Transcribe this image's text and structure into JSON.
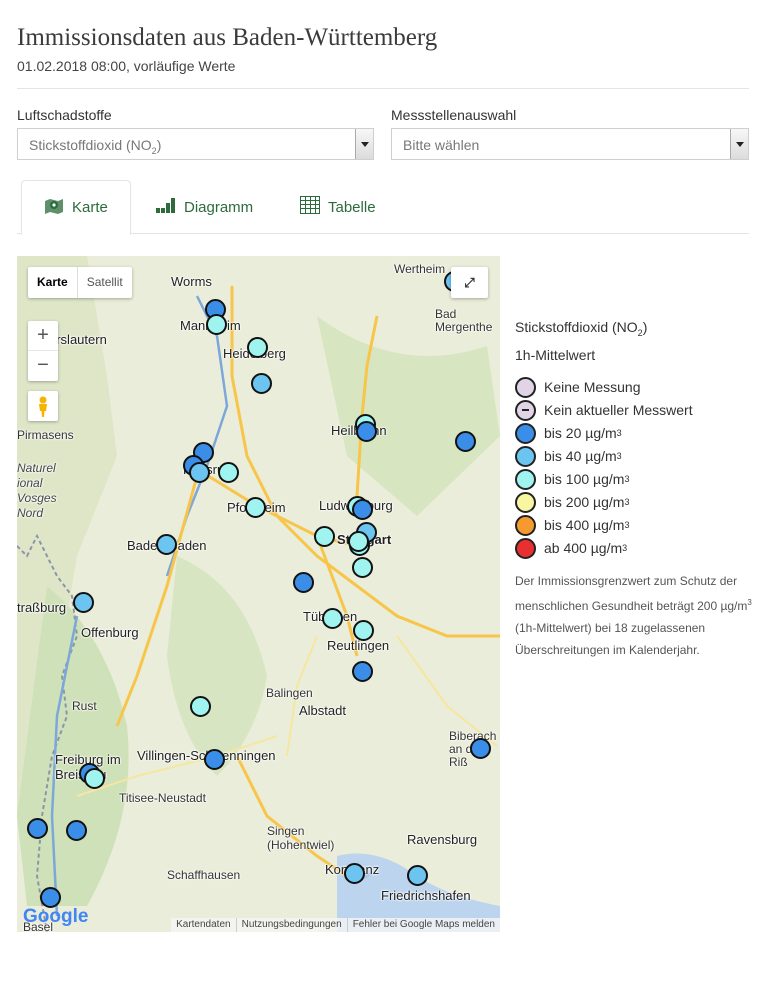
{
  "header": {
    "title": "Immissionsdaten aus Baden-Württemberg",
    "subtitle": "01.02.2018 08:00, vorläufige Werte"
  },
  "filters": {
    "pollutant_label": "Luftschadstoffe",
    "pollutant_value": "Stickstoffdioxid (NO",
    "pollutant_value_sub": "2",
    "pollutant_value_end": ")",
    "station_label": "Messstellenauswahl",
    "station_value": "Bitte wählen"
  },
  "tabs": [
    {
      "label": "Karte",
      "icon": "map-pin-icon"
    },
    {
      "label": "Diagramm",
      "icon": "bar-chart-icon"
    },
    {
      "label": "Tabelle",
      "icon": "table-icon"
    }
  ],
  "map": {
    "maptype_map": "Karte",
    "maptype_satellite": "Satellit",
    "zoom_in": "+",
    "zoom_out": "−",
    "fullscreen": "⤢",
    "google": "Google",
    "attribution": [
      "Kartendaten",
      "Nutzungsbedingungen",
      "Fehler bei Google Maps melden"
    ],
    "labels": {
      "worms": "Worms",
      "mannheim": "Mannheim",
      "heidelberg": "Heidelberg",
      "kaiserslautern": "erslautern",
      "pirmasens": "Pirmasens",
      "karlsruhe": "Karlsruhe",
      "pforzheim": "Pforzheim",
      "baden_baden": "Baden-Baden",
      "heilbronn": "Heilbronn",
      "ludwigsburg": "Ludwigsburg",
      "stuttgart": "Stuttgart",
      "wertheim": "Wertheim",
      "bad_mergentheim": "Bad Mergenthe",
      "strassburg": "traßburg",
      "offenburg": "Offenburg",
      "tuebingen": "Tübingen",
      "reutlingen": "Reutlingen",
      "balingen": "Balingen",
      "albstadt": "Albstadt",
      "rust": "Rust",
      "freiburg": "Freiburg im Breisgau",
      "villingen": "Villingen-Schwenningen",
      "titisee": "Titisee-Neustadt",
      "singen": "Singen (Hohentwiel)",
      "schaffhausen": "Schaffhausen",
      "konstanz": "Konstanz",
      "ravensburg": "Ravensburg",
      "friedrichshafen": "Friedrichshafen",
      "biberach": "Biberach an der Riß",
      "basel": "Basel",
      "vosges": "Naturel ional Vosges Nord"
    },
    "stations": [
      {
        "level": "bis 20 µg/m³"
      },
      {
        "level": "bis 100 µg/m³"
      },
      {
        "level": "bis 100 µg/m³"
      },
      {
        "level": "bis 40 µg/m³"
      },
      {
        "level": "bis 20 µg/m³"
      },
      {
        "level": "bis 20 µg/m³"
      },
      {
        "level": "bis 40 µg/m³"
      },
      {
        "level": "bis 100 µg/m³"
      },
      {
        "level": "bis 100 µg/m³"
      },
      {
        "level": "bis 20 µg/m³"
      },
      {
        "level": "bis 20 µg/m³"
      },
      {
        "level": "bis 100 µg/m³"
      },
      {
        "level": "bis 100 µg/m³"
      },
      {
        "level": "bis 20 µg/m³"
      },
      {
        "level": "bis 40 µg/m³"
      },
      {
        "level": "bis 100 µg/m³"
      },
      {
        "level": "bis 40 µg/m³"
      },
      {
        "level": "bis 100 µg/m³"
      },
      {
        "level": "bis 100 µg/m³"
      },
      {
        "level": "bis 100 µg/m³"
      },
      {
        "level": "bis 20 µg/m³"
      },
      {
        "level": "bis 40 µg/m³"
      },
      {
        "level": "bis 100 µg/m³"
      },
      {
        "level": "bis 100 µg/m³"
      },
      {
        "level": "bis 20 µg/m³"
      },
      {
        "level": "bis 100 µg/m³"
      },
      {
        "level": "bis 20 µg/m³"
      },
      {
        "level": "bis 20 µg/m³"
      },
      {
        "level": "bis 100 µg/m³"
      },
      {
        "level": "bis 20 µg/m³"
      },
      {
        "level": "bis 20 µg/m³"
      },
      {
        "level": "bis 40 µg/m³"
      },
      {
        "level": "bis 40 µg/m³"
      },
      {
        "level": "bis 20 µg/m³"
      },
      {
        "level": "bis 40 µg/m³"
      },
      {
        "level": "bis 20 µg/m³"
      }
    ]
  },
  "legend": {
    "title_main": "Stickstoffdioxid (NO",
    "title_sub": "2",
    "title_end": ")",
    "title_line2": "1h-Mittelwert",
    "items": [
      {
        "label": "Keine Messung",
        "unit": "",
        "color": "#e0d4e6"
      },
      {
        "label": "Kein aktueller Messwert",
        "unit": "",
        "color": "#e0d4e6"
      },
      {
        "label": "bis 20 µg/m",
        "unit": "3",
        "color": "#3a8ee8"
      },
      {
        "label": "bis 40 µg/m",
        "unit": "3",
        "color": "#6cc4f0"
      },
      {
        "label": "bis 100 µg/m",
        "unit": "3",
        "color": "#9ff4f0"
      },
      {
        "label": "bis 200 µg/m",
        "unit": "3",
        "color": "#f8f6a0"
      },
      {
        "label": "bis 400 µg/m",
        "unit": "3",
        "color": "#f59a30"
      },
      {
        "label": "ab 400 µg/m",
        "unit": "3",
        "color": "#e83030"
      }
    ],
    "note_a": "Der Immissionsgrenzwert zum Schutz der menschlichen Gesundheit beträgt 200 µg/m",
    "note_sup": "3",
    "note_b": " (1h-Mittelwert) bei 18 zugelassenen Überschreitungen im Kalenderjahr."
  }
}
